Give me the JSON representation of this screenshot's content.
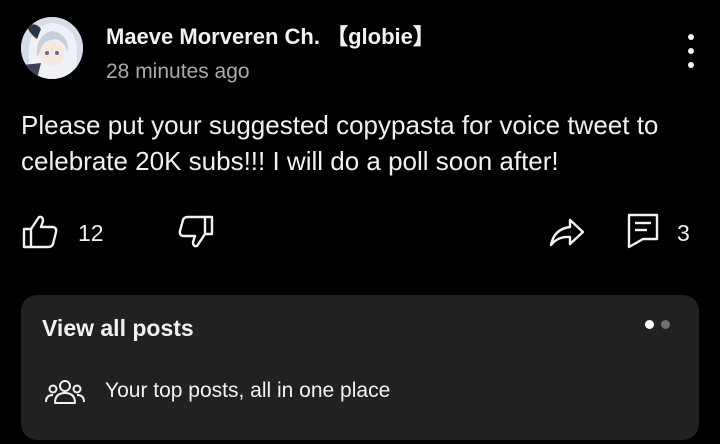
{
  "post": {
    "author": "Maeve Morveren Ch. 【globie】",
    "time": "28 minutes ago",
    "text": "Please put your suggested copypasta for voice tweet to celebrate 20K subs!!! I will do a poll soon after!",
    "like_count": "12",
    "comment_count": "3"
  },
  "card": {
    "title": "View all posts",
    "subtitle": "Your top posts, all in one place",
    "active_page": 1,
    "page_count": 2
  },
  "colors": {
    "background": "#000000",
    "card": "#212121",
    "text": "#f1f1f1",
    "secondary_text": "#aaaaaa",
    "dot_active": "#ffffff",
    "dot_inactive": "#717171"
  },
  "icons": [
    "avatar-image",
    "more-vert-icon",
    "thumb-up-icon",
    "thumb-down-icon",
    "share-icon",
    "comment-icon",
    "people-icon"
  ]
}
